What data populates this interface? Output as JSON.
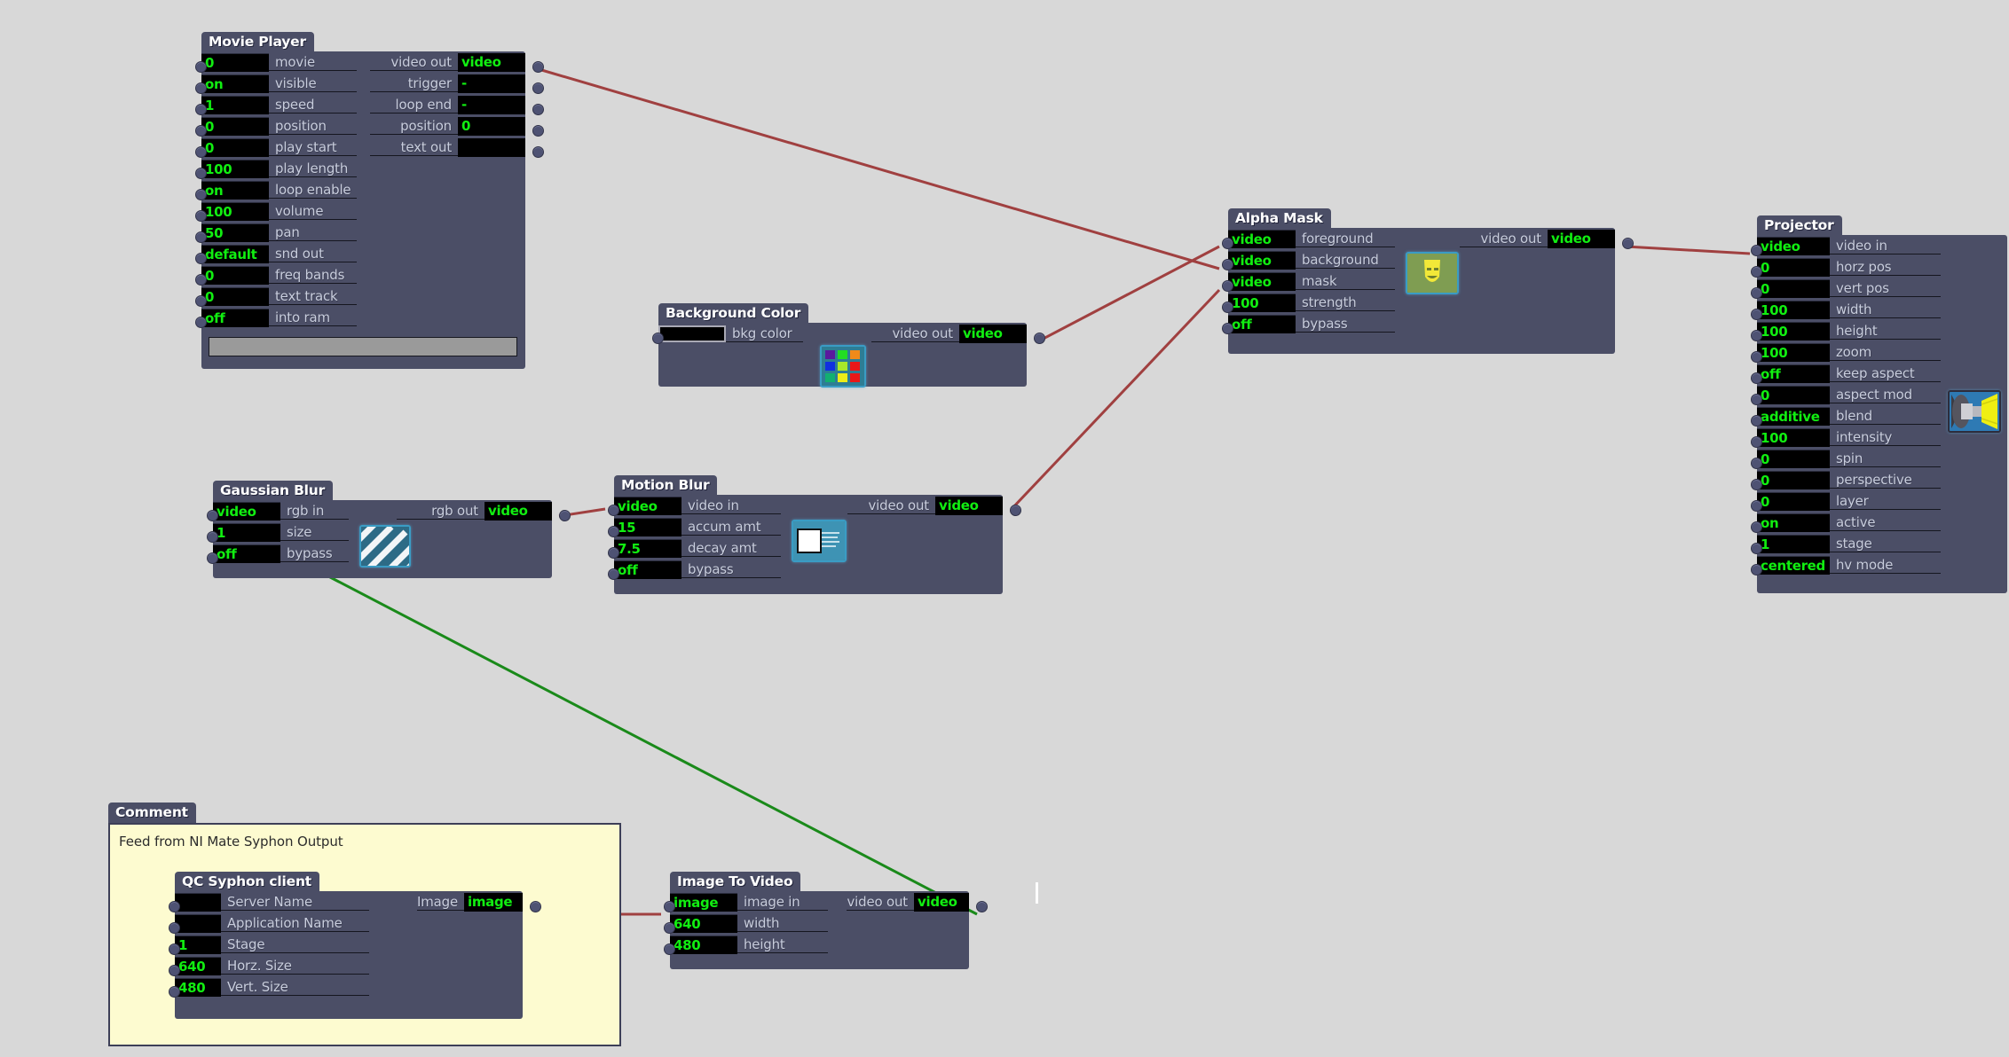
{
  "app": {
    "canvas_background": "#d8d8d8",
    "node_color": "#4b4e66",
    "value_text_color": "#11ee11",
    "wire_video_color": "#a04040",
    "wire_image_color": "#1a8a1a",
    "comment_fill": "#fdfbd0"
  },
  "nodes": {
    "movie_player": {
      "title": "Movie Player",
      "inputs": [
        {
          "value": "0",
          "label": "movie"
        },
        {
          "value": "on",
          "label": "visible"
        },
        {
          "value": "1",
          "label": "speed"
        },
        {
          "value": "0",
          "label": "position"
        },
        {
          "value": "0",
          "label": "play start"
        },
        {
          "value": "100",
          "label": "play length"
        },
        {
          "value": "on",
          "label": "loop enable"
        },
        {
          "value": "100",
          "label": "volume"
        },
        {
          "value": "50",
          "label": "pan"
        },
        {
          "value": "default",
          "label": "snd out"
        },
        {
          "value": "0",
          "label": "freq bands"
        },
        {
          "value": "0",
          "label": "text track"
        },
        {
          "value": "off",
          "label": "into ram"
        }
      ],
      "outputs": [
        {
          "label": "video out",
          "value": "video"
        },
        {
          "label": "trigger",
          "value": "-"
        },
        {
          "label": "loop end",
          "value": "-"
        },
        {
          "label": "position",
          "value": "0"
        },
        {
          "label": "text out",
          "value": ""
        }
      ]
    },
    "background_color": {
      "title": "Background Color",
      "inputs": [
        {
          "value": "",
          "label": "bkg color",
          "widget": "colorwell"
        }
      ],
      "outputs": [
        {
          "label": "video out",
          "value": "video"
        }
      ],
      "icon": "color-palette-icon"
    },
    "alpha_mask": {
      "title": "Alpha Mask",
      "inputs": [
        {
          "value": "video",
          "label": "foreground"
        },
        {
          "value": "video",
          "label": "background"
        },
        {
          "value": "video",
          "label": "mask"
        },
        {
          "value": "100",
          "label": "strength"
        },
        {
          "value": "off",
          "label": "bypass"
        }
      ],
      "outputs": [
        {
          "label": "video out",
          "value": "video"
        }
      ],
      "icon": "theatre-mask-icon"
    },
    "projector": {
      "title": "Projector",
      "inputs": [
        {
          "value": "video",
          "label": "video in"
        },
        {
          "value": "0",
          "label": "horz pos"
        },
        {
          "value": "0",
          "label": "vert pos"
        },
        {
          "value": "100",
          "label": "width"
        },
        {
          "value": "100",
          "label": "height"
        },
        {
          "value": "100",
          "label": "zoom"
        },
        {
          "value": "off",
          "label": "keep aspect"
        },
        {
          "value": "0",
          "label": "aspect mod"
        },
        {
          "value": "additive",
          "label": "blend"
        },
        {
          "value": "100",
          "label": "intensity"
        },
        {
          "value": "0",
          "label": "spin"
        },
        {
          "value": "0",
          "label": "perspective"
        },
        {
          "value": "0",
          "label": "layer"
        },
        {
          "value": "on",
          "label": "active"
        },
        {
          "value": "1",
          "label": "stage"
        },
        {
          "value": "centered",
          "label": "hv mode"
        }
      ],
      "outputs": [],
      "icon": "projector-icon"
    },
    "gaussian_blur": {
      "title": "Gaussian Blur",
      "inputs": [
        {
          "value": "video",
          "label": "rgb in"
        },
        {
          "value": "1",
          "label": "size"
        },
        {
          "value": "off",
          "label": "bypass"
        }
      ],
      "outputs": [
        {
          "label": "rgb out",
          "value": "video"
        }
      ],
      "icon": "diagonal-stripes-icon"
    },
    "motion_blur": {
      "title": "Motion Blur",
      "inputs": [
        {
          "value": "video",
          "label": "video in"
        },
        {
          "value": "15",
          "label": "accum amt"
        },
        {
          "value": "7.5",
          "label": "decay amt"
        },
        {
          "value": "off",
          "label": "bypass"
        }
      ],
      "outputs": [
        {
          "label": "video out",
          "value": "video"
        }
      ],
      "icon": "motion-trail-icon"
    },
    "comment": {
      "title": "Comment",
      "text": "Feed from NI Mate Syphon Output"
    },
    "qc_syphon_client": {
      "title": "QC Syphon client",
      "inputs": [
        {
          "value": "",
          "label": "Server Name"
        },
        {
          "value": "",
          "label": "Application Name"
        },
        {
          "value": "1",
          "label": "Stage"
        },
        {
          "value": "640",
          "label": "Horz. Size"
        },
        {
          "value": "480",
          "label": "Vert. Size"
        }
      ],
      "outputs": [
        {
          "label": "Image",
          "value": "image"
        }
      ]
    },
    "image_to_video": {
      "title": "Image To Video",
      "inputs": [
        {
          "value": "image",
          "label": "image in"
        },
        {
          "value": "640",
          "label": "width"
        },
        {
          "value": "480",
          "label": "height"
        }
      ],
      "outputs": [
        {
          "label": "video out",
          "value": "video"
        }
      ]
    }
  }
}
